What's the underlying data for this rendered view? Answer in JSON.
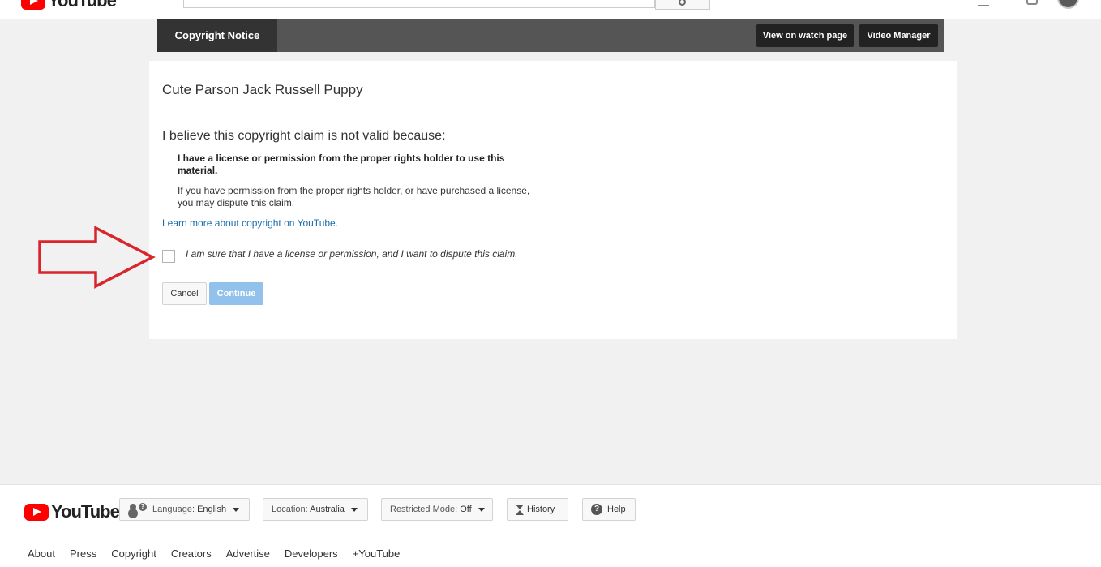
{
  "masthead": {
    "logo_text": "YouTube",
    "search_placeholder": "Search"
  },
  "tabbar": {
    "active_tab": "Copyright Notice",
    "view_on_watch_page": "View on watch page",
    "video_manager": "Video Manager"
  },
  "card": {
    "video_title": "Cute Parson Jack Russell Puppy",
    "claim_heading": "I believe this copyright claim is not valid because:",
    "reason_bold": "I have a license or permission from the proper rights holder to use this material.",
    "reason_desc": "If you have permission from the proper rights holder, or have purchased a license, you may dispute this claim.",
    "learn_more": "Learn more about copyright on YouTube.",
    "confirm_label": "I am sure that I have a license or permission, and I want to dispute this claim.",
    "confirm_checked": false,
    "cancel_label": "Cancel",
    "continue_label": "Continue"
  },
  "annotation": {
    "arrow_color": "#d9262c"
  },
  "footer": {
    "logo_text": "YouTube",
    "language_label": "Language:",
    "language_value": "English",
    "location_label": "Location:",
    "location_value": "Australia",
    "restricted_label": "Restricted Mode:",
    "restricted_value": "Off",
    "history_label": "History",
    "help_label": "Help",
    "links": [
      "About",
      "Press",
      "Copyright",
      "Creators",
      "Advertise",
      "Developers",
      "+YouTube"
    ]
  },
  "colors": {
    "brand_red": "#ff0000",
    "link_blue": "#1b6ca8",
    "continue_disabled": "#92c1eb"
  }
}
